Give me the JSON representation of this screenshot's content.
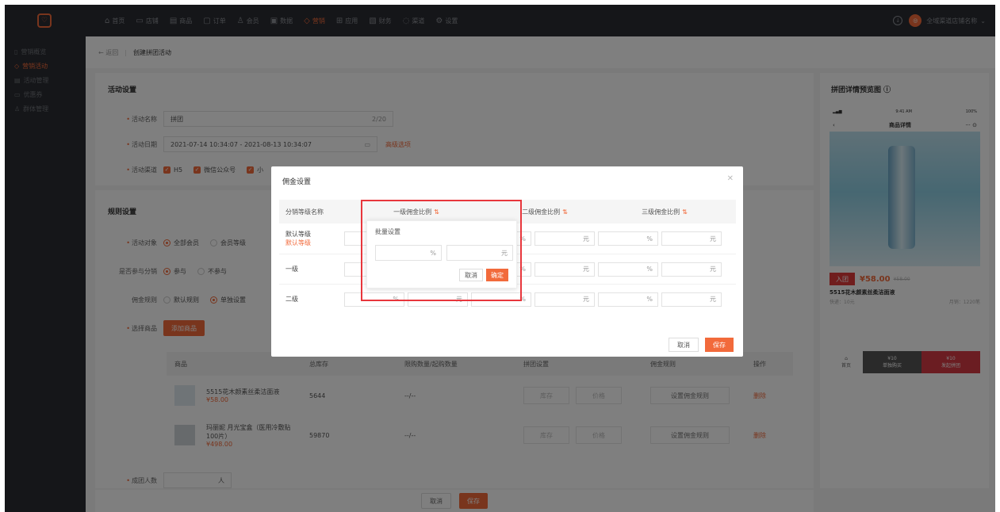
{
  "nav": {
    "items": [
      {
        "icon": "⌂",
        "label": "首页"
      },
      {
        "icon": "▭",
        "label": "店铺"
      },
      {
        "icon": "▤",
        "label": "商品"
      },
      {
        "icon": "▢",
        "label": "订单"
      },
      {
        "icon": "♙",
        "label": "会员"
      },
      {
        "icon": "▣",
        "label": "数据"
      },
      {
        "icon": "◇",
        "label": "营销"
      },
      {
        "icon": "⊞",
        "label": "应用"
      },
      {
        "icon": "▧",
        "label": "财务"
      },
      {
        "icon": "◌",
        "label": "渠道"
      },
      {
        "icon": "⚙",
        "label": "设置"
      }
    ],
    "account": "全域渠道店铺名称"
  },
  "sidebar": {
    "items": [
      {
        "icon": "▯",
        "label": "营销概览"
      },
      {
        "icon": "◇",
        "label": "营销活动"
      },
      {
        "icon": "▤",
        "label": "活动管理"
      },
      {
        "icon": "▭",
        "label": "优惠券"
      },
      {
        "icon": "♙",
        "label": "群体管理"
      }
    ]
  },
  "breadcrumb": {
    "back": "← 返回",
    "current": "创建拼团活动"
  },
  "activity": {
    "section_title": "活动设置",
    "name_label": "活动名称",
    "name_value": "拼团",
    "name_count": "2/20",
    "date_label": "活动日期",
    "date_value": "2021-07-14 10:34:07 - 2021-08-13 10:34:07",
    "date_link": "高级选项",
    "channel_label": "活动渠道",
    "channels": [
      "H5",
      "微信公众号",
      "小"
    ]
  },
  "rules": {
    "section_title": "规则设置",
    "target_label": "活动对象",
    "target_options": [
      "全部会员",
      "会员等级"
    ],
    "share_label": "是否参与分销",
    "share_options": [
      "参与",
      "不参与"
    ],
    "commission_label": "佣金规则",
    "commission_options": [
      "默认规则",
      "单独设置"
    ],
    "goods_label": "选择商品",
    "add_goods": "添加商品",
    "team_label": "成团人数",
    "team_unit": "人"
  },
  "product_table": {
    "headers": [
      "商品",
      "总库存",
      "限购数量/起购数量",
      "拼团设置",
      "佣金规则",
      "操作"
    ],
    "rows": [
      {
        "name": "5515花木颜素丝柔洁面液",
        "price": "¥58.00",
        "stock": "5644",
        "limit": "--/--",
        "stock_ph": "库存",
        "price_ph": "价格",
        "rule": "设置佣金规则",
        "action": "删除"
      },
      {
        "name": "玛丽妮 月光宝盒（医用冷敷贴100片）",
        "price": "¥498.00",
        "stock": "59870",
        "limit": "--/--",
        "stock_ph": "库存",
        "price_ph": "价格",
        "rule": "设置佣金规则",
        "action": "删除"
      }
    ]
  },
  "footer": {
    "cancel": "取消",
    "save": "保存"
  },
  "preview": {
    "title": "拼团详情预览图 ⓘ",
    "time": "9:41 AM",
    "battery": "100%",
    "page_title": "商品详情",
    "tag": "入团",
    "price": "¥58.00",
    "old_price": "¥58.00",
    "name": "5515花木颜素丝柔洁面液",
    "shipping": "快递：10元",
    "sales": "月销：1220笔",
    "home": "首页",
    "single_price": "¥10",
    "single_label": "单独购买",
    "group_price": "¥10",
    "group_label": "发起拼团"
  },
  "modal": {
    "title": "佣金设置",
    "headers": [
      "分销等级名称",
      "一级佣金比例",
      "二级佣金比例",
      "三级佣金比例"
    ],
    "rows": [
      {
        "name": "默认等级",
        "tag": "默认等级"
      },
      {
        "name": "一级",
        "tag": ""
      },
      {
        "name": "二级",
        "tag": ""
      }
    ],
    "percent": "%",
    "yuan": "元",
    "cancel": "取消",
    "save": "保存"
  },
  "batch": {
    "title": "批量设置",
    "percent": "%",
    "yuan": "元",
    "cancel": "取消",
    "ok": "确定"
  },
  "colors": {
    "accent": "#f26a3b",
    "highlight": "#e8363c",
    "nav_bg": "#2b2d33"
  }
}
